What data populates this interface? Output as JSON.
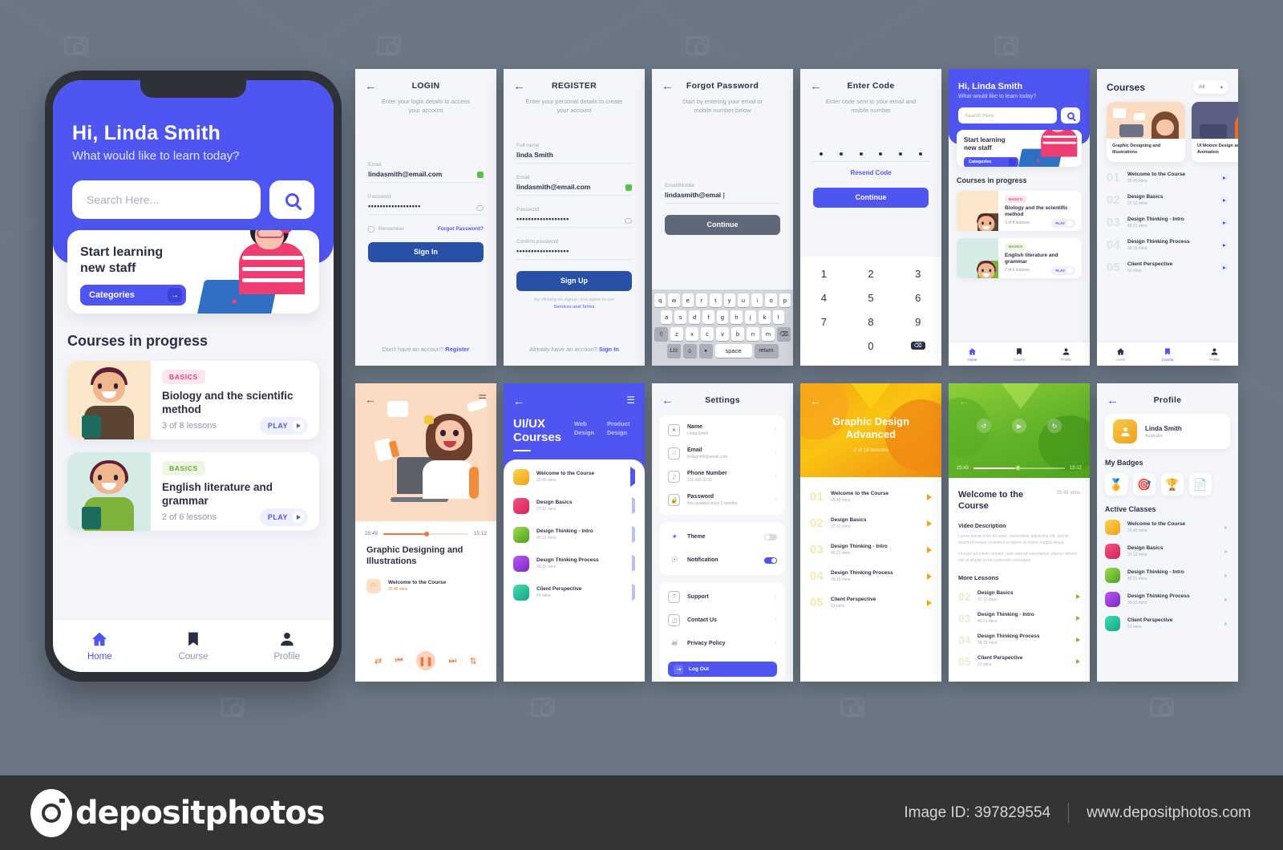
{
  "footer": {
    "brand": "depositphotos",
    "image_id": "Image ID: 397829554",
    "website": "www.depositphotos.com"
  },
  "home": {
    "greeting": "Hi, Linda Smith",
    "subtitle": "What would like to learn today?",
    "search_placeholder": "Search Here...",
    "search_icon": "search-icon",
    "banner_title": "Start learning\nnew staff",
    "banner_line1": "Start learning",
    "banner_line2": "new staff",
    "categories_label": "Categories",
    "categories_arrow": "→",
    "section_title": "Courses in progress",
    "courses": [
      {
        "tag": "BASICS",
        "tag_color": "#ef3d72",
        "tag_bg": "#fde6ee",
        "title": "Biology and the scientific method",
        "lessons": "3 of 8 lessons",
        "play": "PLAY",
        "thumb_bg": "#fbe8cb",
        "shirt": "#5a4533"
      },
      {
        "tag": "BASICS",
        "tag_color": "#6aa441",
        "tag_bg": "#eef6e4",
        "title": "English literature and grammar",
        "lessons": "2 of 6 lessons",
        "play": "PLAY",
        "thumb_bg": "#d6eae6",
        "shirt": "#7fb23a"
      }
    ],
    "nav": [
      {
        "label": "Home",
        "icon": "home-icon",
        "active": true
      },
      {
        "label": "Course",
        "icon": "book-icon",
        "active": false
      },
      {
        "label": "Profile",
        "icon": "person-icon",
        "active": false
      }
    ]
  },
  "login": {
    "title": "LOGIN",
    "subtitle": "Enter your login details to access your account",
    "email_label": "Email",
    "email_value": "lindasmith@email.com",
    "password_label": "Password",
    "password_value": "••••••••••••••••••",
    "remember_label": "Remember",
    "forgot_label": "Forgot Password?",
    "submit": "Sign In",
    "bottom_text": "Don't have an accoun?",
    "bottom_link": "Register"
  },
  "register": {
    "title": "REGISTER",
    "subtitle": "Enter your personal details to create your account",
    "fullname_label": "Full name",
    "fullname_value": "linda Smith",
    "email_label": "Email",
    "email_value": "lindasmith@email.com",
    "password_label": "Password",
    "password_value": "••••••••••••••••••",
    "confirm_label": "Confirm password",
    "confirm_value": "••••••••••••••••••",
    "submit": "Sign Up",
    "legal_text": "By clicking on signup, you agree to our",
    "legal_link": "Services and Terms",
    "bottom_text": "Already have an accoun?",
    "bottom_link": "Sign In"
  },
  "forgot": {
    "title": "Forgot Password",
    "subtitle": "Start by entering your email or mobile number below",
    "field_label": "Email/Mobile",
    "field_value": "lindasmith@emai",
    "submit": "Continue",
    "keyboard": {
      "row1": [
        "q",
        "w",
        "e",
        "r",
        "t",
        "y",
        "u",
        "i",
        "o",
        "p"
      ],
      "row2": [
        "a",
        "s",
        "d",
        "f",
        "g",
        "h",
        "j",
        "k",
        "l"
      ],
      "row3": [
        "⇧",
        "z",
        "x",
        "c",
        "v",
        "b",
        "n",
        "m",
        "⌫"
      ],
      "row4": [
        "123",
        "☺",
        "🎤",
        "space",
        "return"
      ]
    }
  },
  "entercode": {
    "title": "Enter Code",
    "subtitle": "Enter code sent to your email and mobile number",
    "digits": [
      "",
      "",
      "",
      "",
      "",
      ""
    ],
    "resend": "Resend Code",
    "submit": "Continue",
    "numpad": [
      "1",
      "2",
      "3",
      "4",
      "5",
      "6",
      "7",
      "8",
      "9",
      "",
      "0",
      "⌫"
    ]
  },
  "mini_home": {
    "greeting": "Hi, Linda Smith",
    "subtitle": "What would like to learn today?",
    "search_placeholder": "Search Here",
    "banner_line1": "Start learning",
    "banner_line2": "new staff",
    "categories_label": "Categories",
    "section_title": "Courses in progress",
    "courses": [
      {
        "tag": "BASICS",
        "tag_color": "#ef3d72",
        "tag_bg": "#fde6ee",
        "title": "Biology and the scientific method",
        "lessons": "3 of 8 lessons",
        "play": "PLAY",
        "thumb_bg": "#fbe8cb"
      },
      {
        "tag": "BASICS",
        "tag_color": "#6aa441",
        "tag_bg": "#eef6e4",
        "title": "English literature and grammar",
        "lessons": "2 of 6 lessons",
        "play": "PLAY",
        "thumb_bg": "#d6eae6"
      }
    ],
    "nav": [
      {
        "label": "Home",
        "active": true
      },
      {
        "label": "Course",
        "active": false
      },
      {
        "label": "Profile",
        "active": false
      }
    ]
  },
  "courses_panel": {
    "title": "Courses",
    "filter": "All",
    "filter_icon": "chevron-down-icon",
    "cards": [
      {
        "title": "Graphic Designing and Illustrations",
        "bg": "#fbdcc2"
      },
      {
        "title": "UI Motion Design and Animation",
        "bg": "#5b5f86"
      }
    ],
    "lessons": [
      {
        "num": "01",
        "title": "Welcome to the Course",
        "time": "25:45 mins"
      },
      {
        "num": "02",
        "title": "Design Basics",
        "time": "37:12 mins"
      },
      {
        "num": "03",
        "title": "Design Thinking - Intro",
        "time": "45:21 mins"
      },
      {
        "num": "04",
        "title": "Design Thinking Process",
        "time": "39:15 mins"
      },
      {
        "num": "05",
        "title": "Client Perspective",
        "time": "55 mins"
      }
    ],
    "nav": [
      {
        "label": "Home",
        "active": false
      },
      {
        "label": "Course",
        "active": true
      },
      {
        "label": "Profile",
        "active": false
      }
    ]
  },
  "video_course": {
    "back_icon": "back-arrow-icon",
    "menu_icon": "menu-icon",
    "elapsed": "25:45",
    "remaining": "15:12",
    "title": "Graphic Designing and Illustrations",
    "lesson_num": "01",
    "lesson_title": "Welcome to the Course",
    "lesson_time": "25:45 mins",
    "controls": [
      "shuffle-icon",
      "previous-icon",
      "pause-icon",
      "next-icon",
      "repeat-icon"
    ]
  },
  "uiux": {
    "title_line1": "UI/UX",
    "title_line2": "Courses",
    "tabs": [
      {
        "line1": "Web",
        "line2": "Design"
      },
      {
        "line1": "Product",
        "line2": "Design"
      }
    ],
    "lessons": [
      {
        "title": "Welcome to the Course",
        "time": "25:45 mins",
        "color": "#f7c948"
      },
      {
        "title": "Design Basics",
        "time": "37:12 mins",
        "color": "#ec3a6e"
      },
      {
        "title": "Design Thinking - Intro",
        "time": "45:21 mins",
        "color": "#6ab832"
      },
      {
        "title": "Design Thinking Process",
        "time": "39:15 mins",
        "color": "#9b3fd8"
      },
      {
        "title": "Client Perspective",
        "time": "55 mins",
        "color": "#27c2a0"
      }
    ]
  },
  "settings": {
    "title": "Settings",
    "account": [
      {
        "icon": "person-icon",
        "label": "Name",
        "value": "Linda Smith"
      },
      {
        "icon": "mail-icon",
        "label": "Email",
        "value": "lindasmith@email.com"
      },
      {
        "icon": "phone-icon",
        "label": "Phone Number",
        "value": "311-555-2233"
      },
      {
        "icon": "lock-icon",
        "label": "Password",
        "value": "Not updated since 2 months"
      }
    ],
    "toggles": [
      {
        "icon": "brush-icon",
        "label": "Theme",
        "on": false
      },
      {
        "icon": "bell-icon",
        "label": "Notification",
        "on": true
      }
    ],
    "links": [
      {
        "icon": "help-icon",
        "label": "Support"
      },
      {
        "icon": "chat-icon",
        "label": "Contact Us"
      },
      {
        "icon": "shield-icon",
        "label": "Privacy Policy"
      }
    ],
    "logout": "Log Out",
    "logout_icon": "logout-icon"
  },
  "graphic_advanced": {
    "title_line1": "Graphic Design",
    "title_line2": "Advanced",
    "progress": "2 of 18 lessons",
    "lessons": [
      {
        "num": "01",
        "title": "Welcome to the Course",
        "time": "25:45 mins"
      },
      {
        "num": "02",
        "title": "Design Basics",
        "time": "37:12 mins"
      },
      {
        "num": "03",
        "title": "Design Thinking - Intro",
        "time": "45:21 mins"
      },
      {
        "num": "04",
        "title": "Design Thinking Process",
        "time": "39:15 mins"
      },
      {
        "num": "05",
        "title": "Client Perspective",
        "time": "51 mins"
      }
    ]
  },
  "green_video": {
    "elapsed": "25:45",
    "remaining": "15:12",
    "title": "Welcome to the Course",
    "duration": "25:45 mins",
    "desc_label": "Video Description",
    "desc_p1": "Lorem ipsum dolor sit amet, consectetur adipiscing elit, sed do eiusmod tempor incididunt ut labore et dolore magna aliqua.",
    "desc_p2": "Ut enim ad minim veniam, quis nostrud exercitation ullamco laboris nisi ut aliquip ex ea commodo consequat.",
    "more_label": "More Lessons",
    "controls": [
      "replay-icon",
      "play-icon",
      "forward-icon"
    ],
    "lessons": [
      {
        "num": "02",
        "title": "Design Basics",
        "time": "37:12 mins"
      },
      {
        "num": "03",
        "title": "Design Thinking - Intro",
        "time": "45:21 mins"
      },
      {
        "num": "04",
        "title": "Design Thinking Process",
        "time": "39:15 mins"
      },
      {
        "num": "05",
        "title": "Client Perspective",
        "time": "51 mins"
      }
    ]
  },
  "profile": {
    "title": "Profile",
    "name": "Linda Smith",
    "location": "Australia",
    "badges_label": "My Badges",
    "badges": [
      "medal-icon",
      "target-icon",
      "trophy-icon",
      "certificate-icon"
    ],
    "classes_label": "Active Classes",
    "classes": [
      {
        "title": "Welcome to the Course",
        "time": "25:45 mins",
        "color": "#f7c948"
      },
      {
        "title": "Design Basics",
        "time": "37:12 mins",
        "color": "#ec3a6e"
      },
      {
        "title": "Design Thinking - Intro",
        "time": "45:21 mins",
        "color": "#6ab832"
      },
      {
        "title": "Design Thinking Process",
        "time": "39:15 mins",
        "color": "#9b3fd8"
      },
      {
        "title": "Client Perspective",
        "time": "51 mins",
        "color": "#27c2a0"
      }
    ]
  }
}
